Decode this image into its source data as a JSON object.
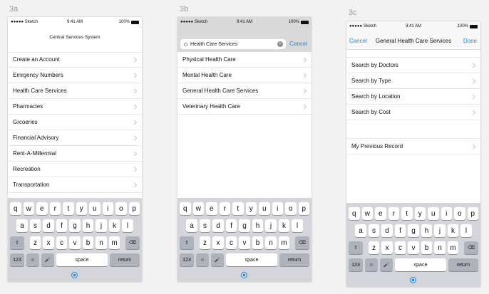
{
  "labels": {
    "a": "3a",
    "b": "3b",
    "c": "3c"
  },
  "status": {
    "carrier": "●●●●● Sketch ",
    "time": "9:41 AM",
    "battery": "100%"
  },
  "screen_a": {
    "title": "Central Services System",
    "items": [
      "Create an Account",
      "Emrgency Numbers",
      "Health Care Services",
      "Pharmacies",
      "Grcoeries",
      "Financial Advisory",
      "Rent-A-Millennial",
      "Recreation",
      "Transportation"
    ]
  },
  "screen_b": {
    "search_value": "Health Care Services",
    "cancel": "Cancel",
    "items": [
      "Physical Health Care",
      "Mental Health Care",
      "General Health Care Services",
      "Veterinary Health Care"
    ]
  },
  "screen_c": {
    "cancel": "Cancel",
    "title": "General Health Care Services",
    "done": "Done",
    "items": [
      "Search by Doctors",
      "Search by Type",
      "Search by Location",
      "Search by Cost"
    ],
    "previous": "My Previous Record"
  },
  "keyboard": {
    "row1": [
      "q",
      "w",
      "e",
      "r",
      "t",
      "y",
      "u",
      "i",
      "o",
      "p"
    ],
    "row2": [
      "a",
      "s",
      "d",
      "f",
      "g",
      "h",
      "j",
      "k",
      "l"
    ],
    "row3": [
      "z",
      "x",
      "c",
      "v",
      "b",
      "n",
      "m"
    ],
    "shift": "⇧",
    "backspace": "⌫",
    "numbers": "123",
    "emoji": "☺",
    "mic": "🎤",
    "space": "space",
    "return": "return"
  },
  "colors": {
    "accent": "#1a8be8",
    "keyboard_bg": "#d3d5db"
  }
}
